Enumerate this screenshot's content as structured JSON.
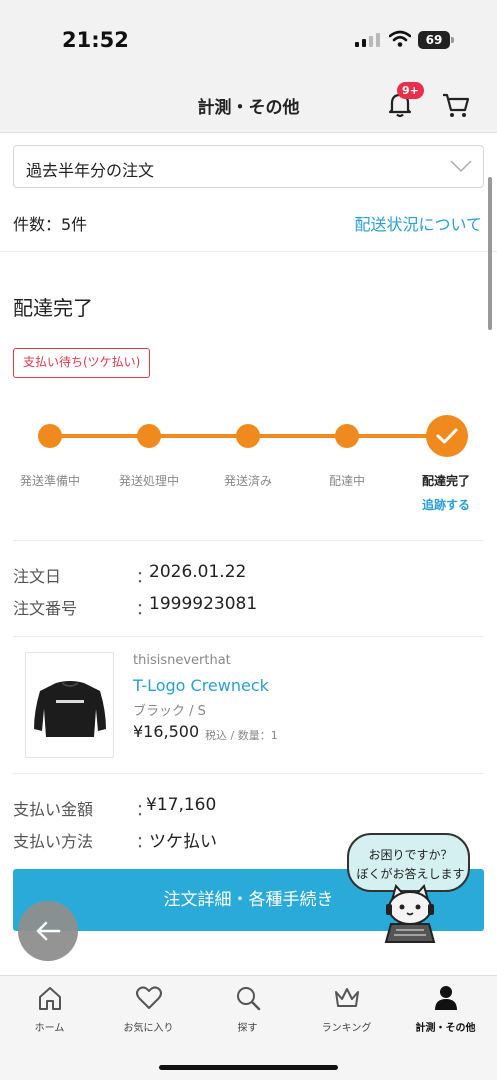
{
  "status_bar": {
    "time": "21:52",
    "battery": "69"
  },
  "header": {
    "title": "計測・その他",
    "notification_badge": "9+"
  },
  "filter": {
    "selected": "過去半年分の注文"
  },
  "summary": {
    "count": "件数：5件",
    "delivery_link": "配送状況について"
  },
  "order": {
    "status_title": "配達完了",
    "payment_tag": "支払い待ち(ツケ払い)",
    "steps": [
      "発送準備中",
      "発送処理中",
      "発送済み",
      "配達中",
      "配達完了"
    ],
    "current_step": 5,
    "track_link": "追跡する",
    "date_label": "注文日",
    "date_value": "2026.01.22",
    "number_label": "注文番号",
    "number_value": "1999923081",
    "colon": "："
  },
  "product": {
    "brand": "thisisneverthat",
    "name": "T-Logo Crewneck",
    "variant": "ブラック / S",
    "price": "¥16,500",
    "price_note": "税込 / 数量：1"
  },
  "payment": {
    "amount_label": "支払い金額",
    "amount_value": "¥17,160",
    "method_label": "支払い方法",
    "method_value": "ツケ払い"
  },
  "actions": {
    "detail_button": "注文詳細・各種手続き"
  },
  "assistant": {
    "line1": "お困りですか？",
    "line2": "ぼくがお答えします"
  },
  "tabbar": {
    "items": [
      {
        "label": "ホーム",
        "icon": "home-icon"
      },
      {
        "label": "お気に入り",
        "icon": "heart-icon"
      },
      {
        "label": "探す",
        "icon": "search-icon"
      },
      {
        "label": "ランキング",
        "icon": "crown-icon"
      },
      {
        "label": "計測・その他",
        "icon": "person-icon"
      }
    ],
    "active": 4
  },
  "colors": {
    "accent": "#2aaad8",
    "progress": "#f08a1e",
    "alert": "#e0384c",
    "badge": "#e8304a"
  }
}
